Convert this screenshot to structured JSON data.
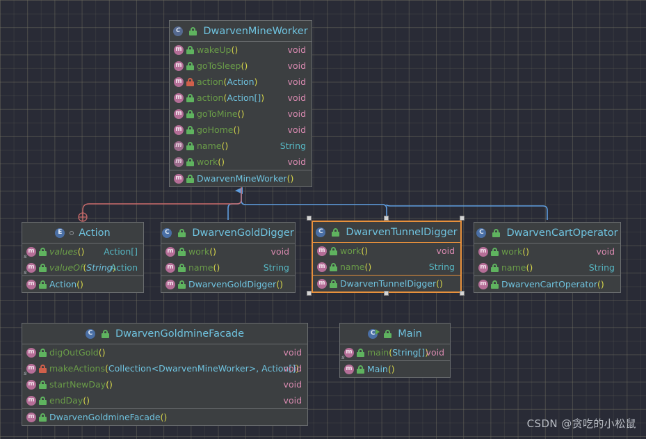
{
  "theme": {
    "canvas_bg": "#292b36",
    "node_bg": "#3c3f41",
    "node_border": "#6a6d6f",
    "selection_border": "#e8913c",
    "title_color": "#6fc3df",
    "method_color": "#6a9c48",
    "return_primitive_color": "#d98ab0",
    "return_object_color": "#56b6c2",
    "inheritance_edge_color": "#5f9ee0",
    "dependency_edge_color": "#c96a6a"
  },
  "watermark": "CSDN @贪吃的小松鼠",
  "nodes": [
    {
      "id": "DwarvenMineWorker",
      "title": "DwarvenMineWorker",
      "kind": "abstract-class",
      "kind_icon": "abstract-class-icon",
      "selected": false,
      "members": [
        {
          "name": "wakeUp",
          "args": "",
          "ret": "void",
          "vis": "public",
          "static": false,
          "abstract": false,
          "ctor": false
        },
        {
          "name": "goToSleep",
          "args": "",
          "ret": "void",
          "vis": "public",
          "static": false,
          "abstract": false,
          "ctor": false
        },
        {
          "name": "action",
          "args": "Action",
          "ret": "void",
          "vis": "private",
          "static": false,
          "abstract": false,
          "ctor": false
        },
        {
          "name": "action",
          "args": "Action[]",
          "ret": "void",
          "vis": "public",
          "static": false,
          "abstract": false,
          "ctor": false
        },
        {
          "name": "goToMine",
          "args": "",
          "ret": "void",
          "vis": "public",
          "static": false,
          "abstract": false,
          "ctor": false
        },
        {
          "name": "goHome",
          "args": "",
          "ret": "void",
          "vis": "public",
          "static": false,
          "abstract": false,
          "ctor": false
        },
        {
          "name": "name",
          "args": "",
          "ret": "String",
          "vis": "public",
          "static": false,
          "abstract": true,
          "ctor": false
        },
        {
          "name": "work",
          "args": "",
          "ret": "void",
          "vis": "public",
          "static": false,
          "abstract": true,
          "ctor": false
        }
      ],
      "constructors": [
        {
          "name": "DwarvenMineWorker",
          "args": "",
          "ret": "",
          "vis": "public",
          "static": false,
          "abstract": false,
          "ctor": true
        }
      ]
    },
    {
      "id": "Action",
      "title": "Action",
      "kind": "enum",
      "kind_icon": "enum-icon",
      "selected": false,
      "members": [
        {
          "name": "values",
          "args": "",
          "ret": "Action[]",
          "vis": "public",
          "static": true,
          "abstract": false,
          "ctor": false
        },
        {
          "name": "valueOf",
          "args": "String",
          "ret": "Action",
          "vis": "public",
          "static": true,
          "abstract": false,
          "ctor": false
        }
      ],
      "constructors": [
        {
          "name": "Action",
          "args": "",
          "ret": "",
          "vis": "public",
          "static": false,
          "abstract": false,
          "ctor": true
        }
      ]
    },
    {
      "id": "DwarvenGoldDigger",
      "title": "DwarvenGoldDigger",
      "kind": "class",
      "kind_icon": "class-icon",
      "selected": false,
      "members": [
        {
          "name": "work",
          "args": "",
          "ret": "void",
          "vis": "public",
          "static": false,
          "abstract": false,
          "ctor": false
        },
        {
          "name": "name",
          "args": "",
          "ret": "String",
          "vis": "public",
          "static": false,
          "abstract": false,
          "ctor": false
        }
      ],
      "constructors": [
        {
          "name": "DwarvenGoldDigger",
          "args": "",
          "ret": "",
          "vis": "public",
          "static": false,
          "abstract": false,
          "ctor": true
        }
      ]
    },
    {
      "id": "DwarvenTunnelDigger",
      "title": "DwarvenTunnelDigger",
      "kind": "class",
      "kind_icon": "class-icon",
      "selected": true,
      "members": [
        {
          "name": "work",
          "args": "",
          "ret": "void",
          "vis": "public",
          "static": false,
          "abstract": false,
          "ctor": false
        },
        {
          "name": "name",
          "args": "",
          "ret": "String",
          "vis": "public",
          "static": false,
          "abstract": false,
          "ctor": false
        }
      ],
      "constructors": [
        {
          "name": "DwarvenTunnelDigger",
          "args": "",
          "ret": "",
          "vis": "public",
          "static": false,
          "abstract": false,
          "ctor": true
        }
      ]
    },
    {
      "id": "DwarvenCartOperator",
      "title": "DwarvenCartOperator",
      "kind": "class",
      "kind_icon": "class-icon",
      "selected": false,
      "members": [
        {
          "name": "work",
          "args": "",
          "ret": "void",
          "vis": "public",
          "static": false,
          "abstract": false,
          "ctor": false
        },
        {
          "name": "name",
          "args": "",
          "ret": "String",
          "vis": "public",
          "static": false,
          "abstract": false,
          "ctor": false
        }
      ],
      "constructors": [
        {
          "name": "DwarvenCartOperator",
          "args": "",
          "ret": "",
          "vis": "public",
          "static": false,
          "abstract": false,
          "ctor": true
        }
      ]
    },
    {
      "id": "DwarvenGoldmineFacade",
      "title": "DwarvenGoldmineFacade",
      "kind": "class",
      "kind_icon": "class-icon",
      "selected": false,
      "members": [
        {
          "name": "digOutGold",
          "args": "",
          "ret": "void",
          "vis": "public",
          "static": false,
          "abstract": false,
          "ctor": false
        },
        {
          "name": "makeActions",
          "args": "Collection<DwarvenMineWorker>, Action[]",
          "ret": "void",
          "vis": "private",
          "static": true,
          "abstract": false,
          "ctor": false
        },
        {
          "name": "startNewDay",
          "args": "",
          "ret": "void",
          "vis": "public",
          "static": false,
          "abstract": false,
          "ctor": false
        },
        {
          "name": "endDay",
          "args": "",
          "ret": "void",
          "vis": "public",
          "static": false,
          "abstract": false,
          "ctor": false
        }
      ],
      "constructors": [
        {
          "name": "DwarvenGoldmineFacade",
          "args": "",
          "ret": "",
          "vis": "public",
          "static": false,
          "abstract": false,
          "ctor": true
        }
      ]
    },
    {
      "id": "Main",
      "title": "Main",
      "kind": "runnable-class",
      "kind_icon": "runnable-class-icon",
      "selected": false,
      "members": [
        {
          "name": "main",
          "args": "String[]",
          "ret": "void",
          "vis": "public",
          "static": true,
          "abstract": false,
          "ctor": false
        }
      ],
      "constructors": [
        {
          "name": "Main",
          "args": "",
          "ret": "",
          "vis": "public",
          "static": false,
          "abstract": false,
          "ctor": true
        }
      ]
    }
  ],
  "edges": [
    {
      "from": "DwarvenGoldDigger",
      "to": "DwarvenMineWorker",
      "type": "inheritance"
    },
    {
      "from": "DwarvenTunnelDigger",
      "to": "DwarvenMineWorker",
      "type": "inheritance"
    },
    {
      "from": "DwarvenCartOperator",
      "to": "DwarvenMineWorker",
      "type": "inheritance"
    },
    {
      "from": "DwarvenMineWorker",
      "to": "Action",
      "type": "dependency"
    }
  ]
}
